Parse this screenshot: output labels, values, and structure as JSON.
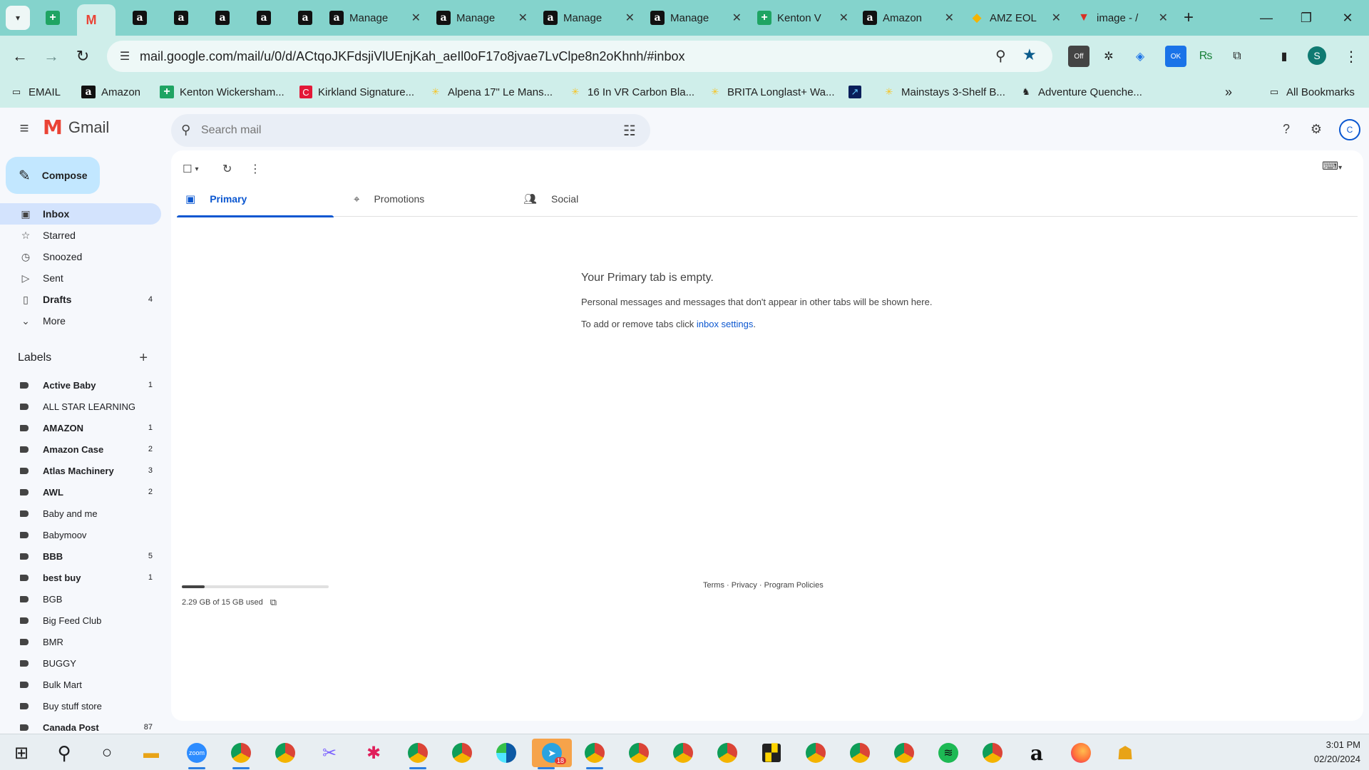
{
  "browser": {
    "tabs": [
      {
        "label": "",
        "icon": "sheets-icon"
      },
      {
        "label": "",
        "icon": "gmail-icon",
        "active": true
      },
      {
        "label": "",
        "icon": "amazon-icon"
      },
      {
        "label": "",
        "icon": "amazon-icon"
      },
      {
        "label": "",
        "icon": "amazon-icon"
      },
      {
        "label": "",
        "icon": "amazon-icon"
      },
      {
        "label": "",
        "icon": "amazon-icon"
      },
      {
        "label": "Manage",
        "icon": "amazon-icon"
      },
      {
        "label": "Manage",
        "icon": "amazon-icon"
      },
      {
        "label": "Manage",
        "icon": "amazon-icon"
      },
      {
        "label": "Manage",
        "icon": "amazon-icon"
      },
      {
        "label": "Kenton V",
        "icon": "sheets-icon"
      },
      {
        "label": "Amazon",
        "icon": "amazon-icon"
      },
      {
        "label": "AMZ EOL",
        "icon": "amz-eol-icon"
      },
      {
        "label": "image - /",
        "icon": "image-icon"
      }
    ],
    "url": "mail.google.com/mail/u/0/d/ACtqoJKFdsjiVlUEnjKah_aeIl0oF17o8jvae7LvClpe8n2oKhnh/#inbox",
    "bookmarks": [
      {
        "label": "EMAIL",
        "icon": "folder-icon"
      },
      {
        "label": "Amazon",
        "icon": "amazon-icon"
      },
      {
        "label": "Kenton Wickersham...",
        "icon": "sheets-icon"
      },
      {
        "label": "Kirkland Signature...",
        "icon": "costco-icon"
      },
      {
        "label": "Alpena 17\" Le Mans...",
        "icon": "walmart-icon"
      },
      {
        "label": "16 In VR Carbon Bla...",
        "icon": "walmart-icon"
      },
      {
        "label": "BRITA Longlast+ Wa...",
        "icon": "walmart-icon"
      },
      {
        "label": "",
        "icon": "chart-bookmark-icon"
      },
      {
        "label": "Mainstays 3-Shelf B...",
        "icon": "walmart-icon"
      },
      {
        "label": "Adventure Quenche...",
        "icon": "stanley-icon"
      },
      {
        "label": "All Bookmarks",
        "icon": "folder-icon"
      }
    ],
    "profile_initial": "S",
    "extension_badges": {
      "off": "Off",
      "ok": "OK"
    }
  },
  "gmail": {
    "logo_text": "Gmail",
    "search_placeholder": "Search mail",
    "compose_label": "Compose",
    "account_initial": "C",
    "nav": [
      {
        "label": "Inbox",
        "icon": "inbox-icon",
        "selected": true,
        "count": ""
      },
      {
        "label": "Starred",
        "icon": "star-icon",
        "count": ""
      },
      {
        "label": "Snoozed",
        "icon": "clock-icon",
        "count": ""
      },
      {
        "label": "Sent",
        "icon": "send-icon",
        "count": ""
      },
      {
        "label": "Drafts",
        "icon": "draft-icon",
        "bold": true,
        "count": "4"
      },
      {
        "label": "More",
        "icon": "chevron-down-icon",
        "count": ""
      }
    ],
    "labels_heading": "Labels",
    "labels": [
      {
        "label": "Active Baby",
        "count": "1",
        "bold": true
      },
      {
        "label": "ALL STAR LEARNING",
        "count": "",
        "bold": false
      },
      {
        "label": "AMAZON",
        "count": "1",
        "bold": true
      },
      {
        "label": "Amazon Case",
        "count": "2",
        "bold": true
      },
      {
        "label": "Atlas Machinery",
        "count": "3",
        "bold": true
      },
      {
        "label": "AWL",
        "count": "2",
        "bold": true
      },
      {
        "label": "Baby and me",
        "count": "",
        "bold": false
      },
      {
        "label": "Babymoov",
        "count": "",
        "bold": false
      },
      {
        "label": "BBB",
        "count": "5",
        "bold": true
      },
      {
        "label": "best buy",
        "count": "1",
        "bold": true
      },
      {
        "label": "BGB",
        "count": "",
        "bold": false
      },
      {
        "label": "Big Feed Club",
        "count": "",
        "bold": false
      },
      {
        "label": "BMR",
        "count": "",
        "bold": false
      },
      {
        "label": "BUGGY",
        "count": "",
        "bold": false
      },
      {
        "label": "Bulk Mart",
        "count": "",
        "bold": false
      },
      {
        "label": "Buy stuff store",
        "count": "",
        "bold": false
      },
      {
        "label": "Canada Post",
        "count": "87",
        "bold": true
      }
    ],
    "tabs": [
      {
        "label": "Primary",
        "icon": "inbox-tab-icon",
        "active": true
      },
      {
        "label": "Promotions",
        "icon": "tag-icon"
      },
      {
        "label": "Social",
        "icon": "people-icon"
      }
    ],
    "empty": {
      "title": "Your Primary tab is empty.",
      "line1": "Personal messages and messages that don't appear in other tabs will be shown here.",
      "line2_prefix": "To add or remove tabs click ",
      "line2_link": "inbox settings",
      "line2_suffix": "."
    },
    "storage": {
      "text": "2.29 GB of 15 GB used",
      "fraction": 0.153
    },
    "footer": {
      "terms": "Terms",
      "privacy": "Privacy",
      "policies": "Program Policies",
      "sep": " · "
    }
  },
  "taskbar": {
    "time": "3:01 PM",
    "date": "02/20/2024",
    "telegram_badge": "18",
    "zoom_label": "zoom"
  },
  "colors": {
    "chrome": "#84d3cc",
    "toolbar": "#cfeeea",
    "gmail_accent": "#0b57d0",
    "compose_bg": "#c2e7ff",
    "selected_nav": "#d3e3fd"
  }
}
